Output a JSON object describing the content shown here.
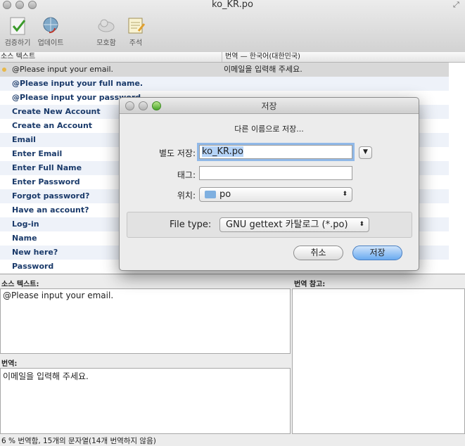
{
  "window": {
    "title": "ko_KR.po"
  },
  "toolbar": {
    "validate_label": "검증하기",
    "update_label": "업데이트",
    "fuzzy_label": "모호함",
    "comment_label": "주석"
  },
  "table": {
    "col_source": "소스 텍스트",
    "col_translation": "번역 — 한국어(대한민국)",
    "rows": [
      {
        "source": "@Please input your email.",
        "translation": "이메일을 입력해 주세요."
      },
      {
        "source": "@Please input your full name.",
        "translation": ""
      },
      {
        "source": "@Please input your password.",
        "translation": ""
      },
      {
        "source": "Create New Account",
        "translation": ""
      },
      {
        "source": "Create an Account",
        "translation": ""
      },
      {
        "source": "Email",
        "translation": ""
      },
      {
        "source": "Enter Email",
        "translation": ""
      },
      {
        "source": "Enter Full Name",
        "translation": ""
      },
      {
        "source": "Enter Password",
        "translation": ""
      },
      {
        "source": "Forgot password?",
        "translation": ""
      },
      {
        "source": "Have an account?",
        "translation": ""
      },
      {
        "source": "Log-in",
        "translation": ""
      },
      {
        "source": "Name",
        "translation": ""
      },
      {
        "source": "New here?",
        "translation": ""
      },
      {
        "source": "Password",
        "translation": ""
      }
    ]
  },
  "panels": {
    "source_label": "소스 텍스트:",
    "source_text": "@Please input your email.",
    "notes_label": "번역 참고:",
    "translation_label": "번역:",
    "translation_text": "이메일을 입력해 주세요."
  },
  "status": {
    "text": "6 % 번역함, 15개의 문자열(14개 번역하지 않음)"
  },
  "dialog": {
    "title": "저장",
    "subtitle": "다른 이름으로 저장...",
    "save_as_label": "별도 저장:",
    "save_as_value": "ko_KR.po",
    "tags_label": "태그:",
    "tags_value": "",
    "where_label": "위치:",
    "where_value": "po",
    "filetype_label": "File type:",
    "filetype_value": "GNU gettext 카탈로그 (*.po)",
    "cancel_label": "취소",
    "save_label": "저장"
  }
}
